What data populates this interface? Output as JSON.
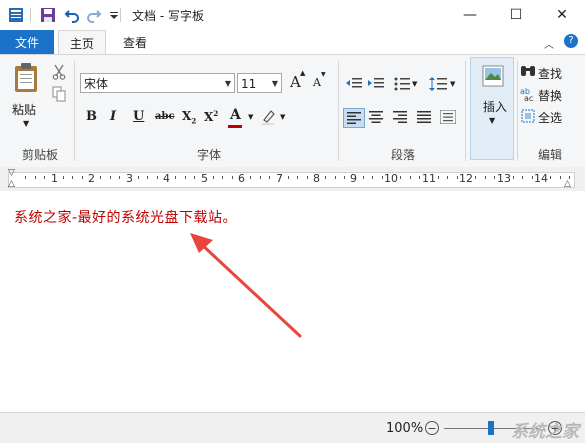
{
  "window": {
    "title": "文档 - 写字板",
    "minimize_glyph": "—",
    "maximize_glyph": "☐",
    "close_glyph": "✕"
  },
  "tabs": {
    "file": "文件",
    "home": "主页",
    "view": "查看"
  },
  "ribbon": {
    "clipboard": {
      "paste": "粘贴",
      "group": "剪贴板"
    },
    "font": {
      "family": "宋体",
      "size": "11",
      "grow": "A",
      "shrink": "A",
      "bold": "B",
      "italic": "I",
      "underline": "U",
      "strike": "abc",
      "subscript": "X",
      "superscript": "X",
      "color_letter": "A",
      "group": "字体"
    },
    "paragraph": {
      "group": "段落"
    },
    "insert": {
      "label": "插入",
      "group": ""
    },
    "editing": {
      "find": "查找",
      "replace": "替换",
      "select_all": "全选",
      "group": "编辑"
    }
  },
  "ruler": {
    "numbers": [
      "1",
      "2",
      "3",
      "4",
      "5",
      "6",
      "7",
      "8",
      "9",
      "10",
      "11",
      "12",
      "13",
      "14"
    ]
  },
  "document": {
    "text": "系统之家-最好的系统光盘下载站。"
  },
  "status": {
    "zoom": "100%",
    "zoom_out": "−",
    "zoom_in": "+",
    "zoom_level": 0.5
  },
  "watermark": "系统之家",
  "colors": {
    "accent": "#1a73c8",
    "text_red": "#c00000",
    "arrow": "#e8453c"
  }
}
